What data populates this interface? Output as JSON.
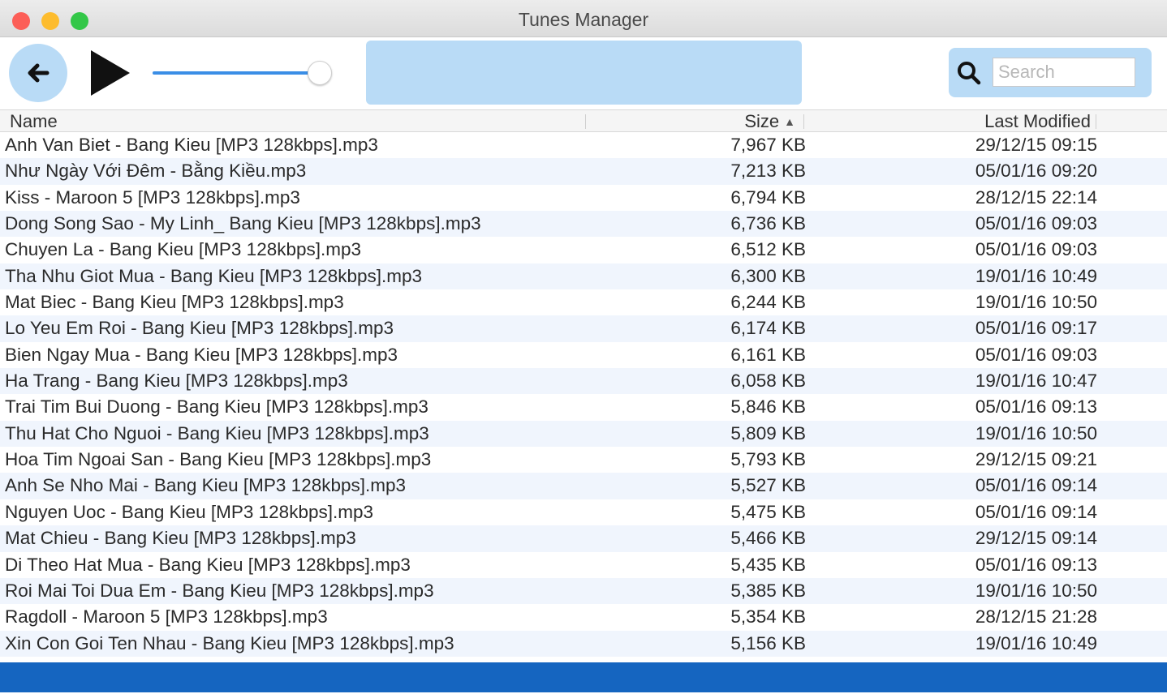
{
  "window": {
    "title": "Tunes Manager"
  },
  "toolbar": {
    "back_icon": "arrow-left-icon",
    "play_icon": "play-icon",
    "volume_level": 0.95,
    "search_icon": "search-icon",
    "search_placeholder": "Search",
    "accent_color": "#b9dbf6"
  },
  "table": {
    "columns": {
      "name": "Name",
      "size": "Size",
      "modified": "Last Modified"
    },
    "sort_column": "size",
    "rows": [
      {
        "name": "Anh Van Biet - Bang Kieu [MP3 128kbps].mp3",
        "size": "7,967 KB",
        "modified": "29/12/15 09:15"
      },
      {
        "name": "Như Ngày Với Đêm - Bằng Kiều.mp3",
        "size": "7,213 KB",
        "modified": "05/01/16 09:20"
      },
      {
        "name": "Kiss - Maroon 5 [MP3 128kbps].mp3",
        "size": "6,794 KB",
        "modified": "28/12/15 22:14"
      },
      {
        "name": "Dong Song Sao - My Linh_ Bang Kieu [MP3 128kbps].mp3",
        "size": "6,736 KB",
        "modified": "05/01/16 09:03"
      },
      {
        "name": "Chuyen La - Bang Kieu [MP3 128kbps].mp3",
        "size": "6,512 KB",
        "modified": "05/01/16 09:03"
      },
      {
        "name": "Tha Nhu Giot Mua - Bang Kieu [MP3 128kbps].mp3",
        "size": "6,300 KB",
        "modified": "19/01/16 10:49"
      },
      {
        "name": "Mat Biec - Bang Kieu [MP3 128kbps].mp3",
        "size": "6,244 KB",
        "modified": "19/01/16 10:50"
      },
      {
        "name": "Lo Yeu Em Roi - Bang Kieu [MP3 128kbps].mp3",
        "size": "6,174 KB",
        "modified": "05/01/16 09:17"
      },
      {
        "name": "Bien Ngay Mua - Bang Kieu [MP3 128kbps].mp3",
        "size": "6,161 KB",
        "modified": "05/01/16 09:03"
      },
      {
        "name": "Ha Trang - Bang Kieu [MP3 128kbps].mp3",
        "size": "6,058 KB",
        "modified": "19/01/16 10:47"
      },
      {
        "name": "Trai Tim Bui Duong - Bang Kieu [MP3 128kbps].mp3",
        "size": "5,846 KB",
        "modified": "05/01/16 09:13"
      },
      {
        "name": "Thu Hat Cho Nguoi - Bang Kieu [MP3 128kbps].mp3",
        "size": "5,809 KB",
        "modified": "19/01/16 10:50"
      },
      {
        "name": "Hoa Tim Ngoai San - Bang Kieu [MP3 128kbps].mp3",
        "size": "5,793 KB",
        "modified": "29/12/15 09:21"
      },
      {
        "name": "Anh Se Nho Mai - Bang Kieu [MP3 128kbps].mp3",
        "size": "5,527 KB",
        "modified": "05/01/16 09:14"
      },
      {
        "name": "Nguyen Uoc - Bang Kieu [MP3 128kbps].mp3",
        "size": "5,475 KB",
        "modified": "05/01/16 09:14"
      },
      {
        "name": "Mat Chieu - Bang Kieu [MP3 128kbps].mp3",
        "size": "5,466 KB",
        "modified": "29/12/15 09:14"
      },
      {
        "name": "Di Theo Hat Mua - Bang Kieu [MP3 128kbps].mp3",
        "size": "5,435 KB",
        "modified": "05/01/16 09:13"
      },
      {
        "name": "Roi Mai Toi Dua Em - Bang Kieu [MP3 128kbps].mp3",
        "size": "5,385 KB",
        "modified": "19/01/16 10:50"
      },
      {
        "name": "Ragdoll - Maroon 5 [MP3 128kbps].mp3",
        "size": "5,354 KB",
        "modified": "28/12/15 21:28"
      },
      {
        "name": "Xin Con Goi Ten Nhau - Bang Kieu [MP3 128kbps].mp3",
        "size": "5,156 KB",
        "modified": "19/01/16 10:49"
      }
    ]
  },
  "statusbar": {
    "color": "#1565c0"
  }
}
